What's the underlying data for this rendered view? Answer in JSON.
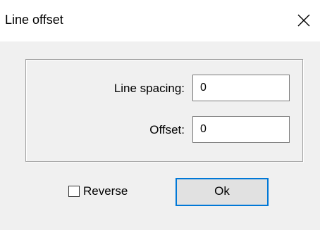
{
  "window": {
    "title": "Line offset",
    "close_icon": "close-icon"
  },
  "fields": {
    "line_spacing": {
      "label": "Line spacing:",
      "value": "0"
    },
    "offset": {
      "label": "Offset:",
      "value": "0"
    }
  },
  "reverse": {
    "label": "Reverse",
    "checked": false
  },
  "ok_button": {
    "label": "Ok"
  },
  "colors": {
    "accent_focus_border": "#0078d7",
    "dialog_background": "#f0f0f0",
    "titlebar_background": "#ffffff",
    "button_face": "#e1e1e1"
  }
}
